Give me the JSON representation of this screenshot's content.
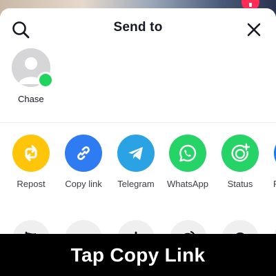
{
  "header": {
    "title": "Send to"
  },
  "contacts": [
    {
      "name": "Chase",
      "online": true
    }
  ],
  "share_options": [
    {
      "label": "Repost",
      "icon": "repost-icon",
      "color": "#fec50a"
    },
    {
      "label": "Copy link",
      "icon": "link-icon",
      "color": "#2f7bf2"
    },
    {
      "label": "Telegram",
      "icon": "telegram-icon",
      "color": "#2aa2e4"
    },
    {
      "label": "WhatsApp",
      "icon": "whatsapp-icon",
      "color": "#26d367"
    },
    {
      "label": "Status",
      "icon": "status-icon",
      "color": "#26d367"
    },
    {
      "label": "F",
      "icon": "facebook-icon",
      "color": "#1877f2"
    }
  ],
  "actions": [
    {
      "icon": "flag-icon"
    },
    {
      "icon": "broken-heart-icon"
    },
    {
      "icon": "download-icon"
    },
    {
      "icon": "duet-icon"
    },
    {
      "icon": "sticker-icon"
    },
    {
      "icon": "more-icon"
    }
  ],
  "caption": {
    "text": "Tap Copy Link"
  },
  "colors": {
    "online_dot": "#20d55f",
    "action_bg": "#efeff0",
    "caption_bg": "#000000",
    "notification_badge": "#fe2c55"
  }
}
